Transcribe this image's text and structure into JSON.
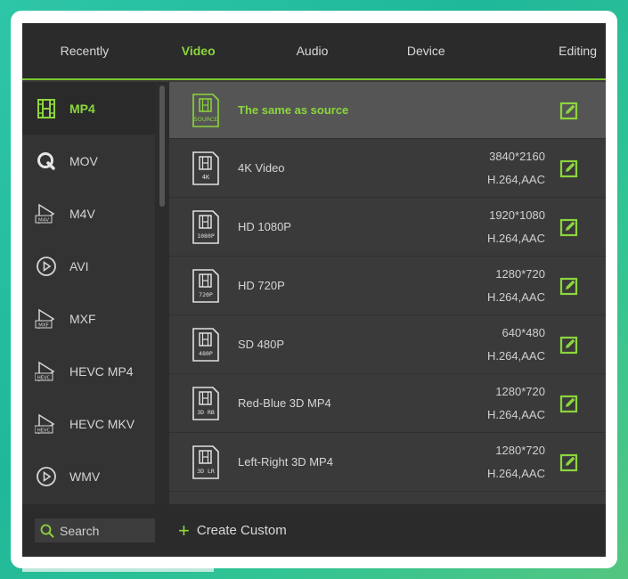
{
  "tabs": [
    {
      "label": "Recently",
      "active": false
    },
    {
      "label": "Video",
      "active": true
    },
    {
      "label": "Audio",
      "active": false
    },
    {
      "label": "Device",
      "active": false
    },
    {
      "label": "Editing",
      "active": false
    }
  ],
  "sidebar": {
    "items": [
      {
        "label": "MP4",
        "icon": "film-icon",
        "active": true
      },
      {
        "label": "MOV",
        "icon": "quicktime-icon",
        "active": false
      },
      {
        "label": "M4V",
        "icon": "m4v-play-icon",
        "active": false
      },
      {
        "label": "AVI",
        "icon": "play-circle-icon",
        "active": false
      },
      {
        "label": "MXF",
        "icon": "mxf-play-icon",
        "active": false
      },
      {
        "label": "HEVC MP4",
        "icon": "hevc-play-icon",
        "active": false
      },
      {
        "label": "HEVC MKV",
        "icon": "hevc-play-icon",
        "active": false
      },
      {
        "label": "WMV",
        "icon": "play-circle-icon",
        "active": false
      }
    ]
  },
  "formats": [
    {
      "name": "The same as source",
      "badge": "SOURCE",
      "resolution": "",
      "codec": "",
      "selected": true
    },
    {
      "name": "4K Video",
      "badge": "4K",
      "resolution": "3840*2160",
      "codec": "H.264,AAC",
      "selected": false
    },
    {
      "name": "HD 1080P",
      "badge": "1080P",
      "resolution": "1920*1080",
      "codec": "H.264,AAC",
      "selected": false
    },
    {
      "name": "HD 720P",
      "badge": "720P",
      "resolution": "1280*720",
      "codec": "H.264,AAC",
      "selected": false
    },
    {
      "name": "SD 480P",
      "badge": "480P",
      "resolution": "640*480",
      "codec": "H.264,AAC",
      "selected": false
    },
    {
      "name": "Red-Blue 3D MP4",
      "badge": "3D RB",
      "resolution": "1280*720",
      "codec": "H.264,AAC",
      "selected": false
    },
    {
      "name": "Left-Right 3D MP4",
      "badge": "3D LR",
      "resolution": "1280*720",
      "codec": "H.264,AAC",
      "selected": false
    }
  ],
  "bottom": {
    "search_placeholder": "Search",
    "create_label": "Create Custom",
    "create_icon": "plus-icon"
  },
  "colors": {
    "accent": "#8cd63c",
    "panel": "#3a3a3a",
    "header": "#2b2b2b"
  }
}
